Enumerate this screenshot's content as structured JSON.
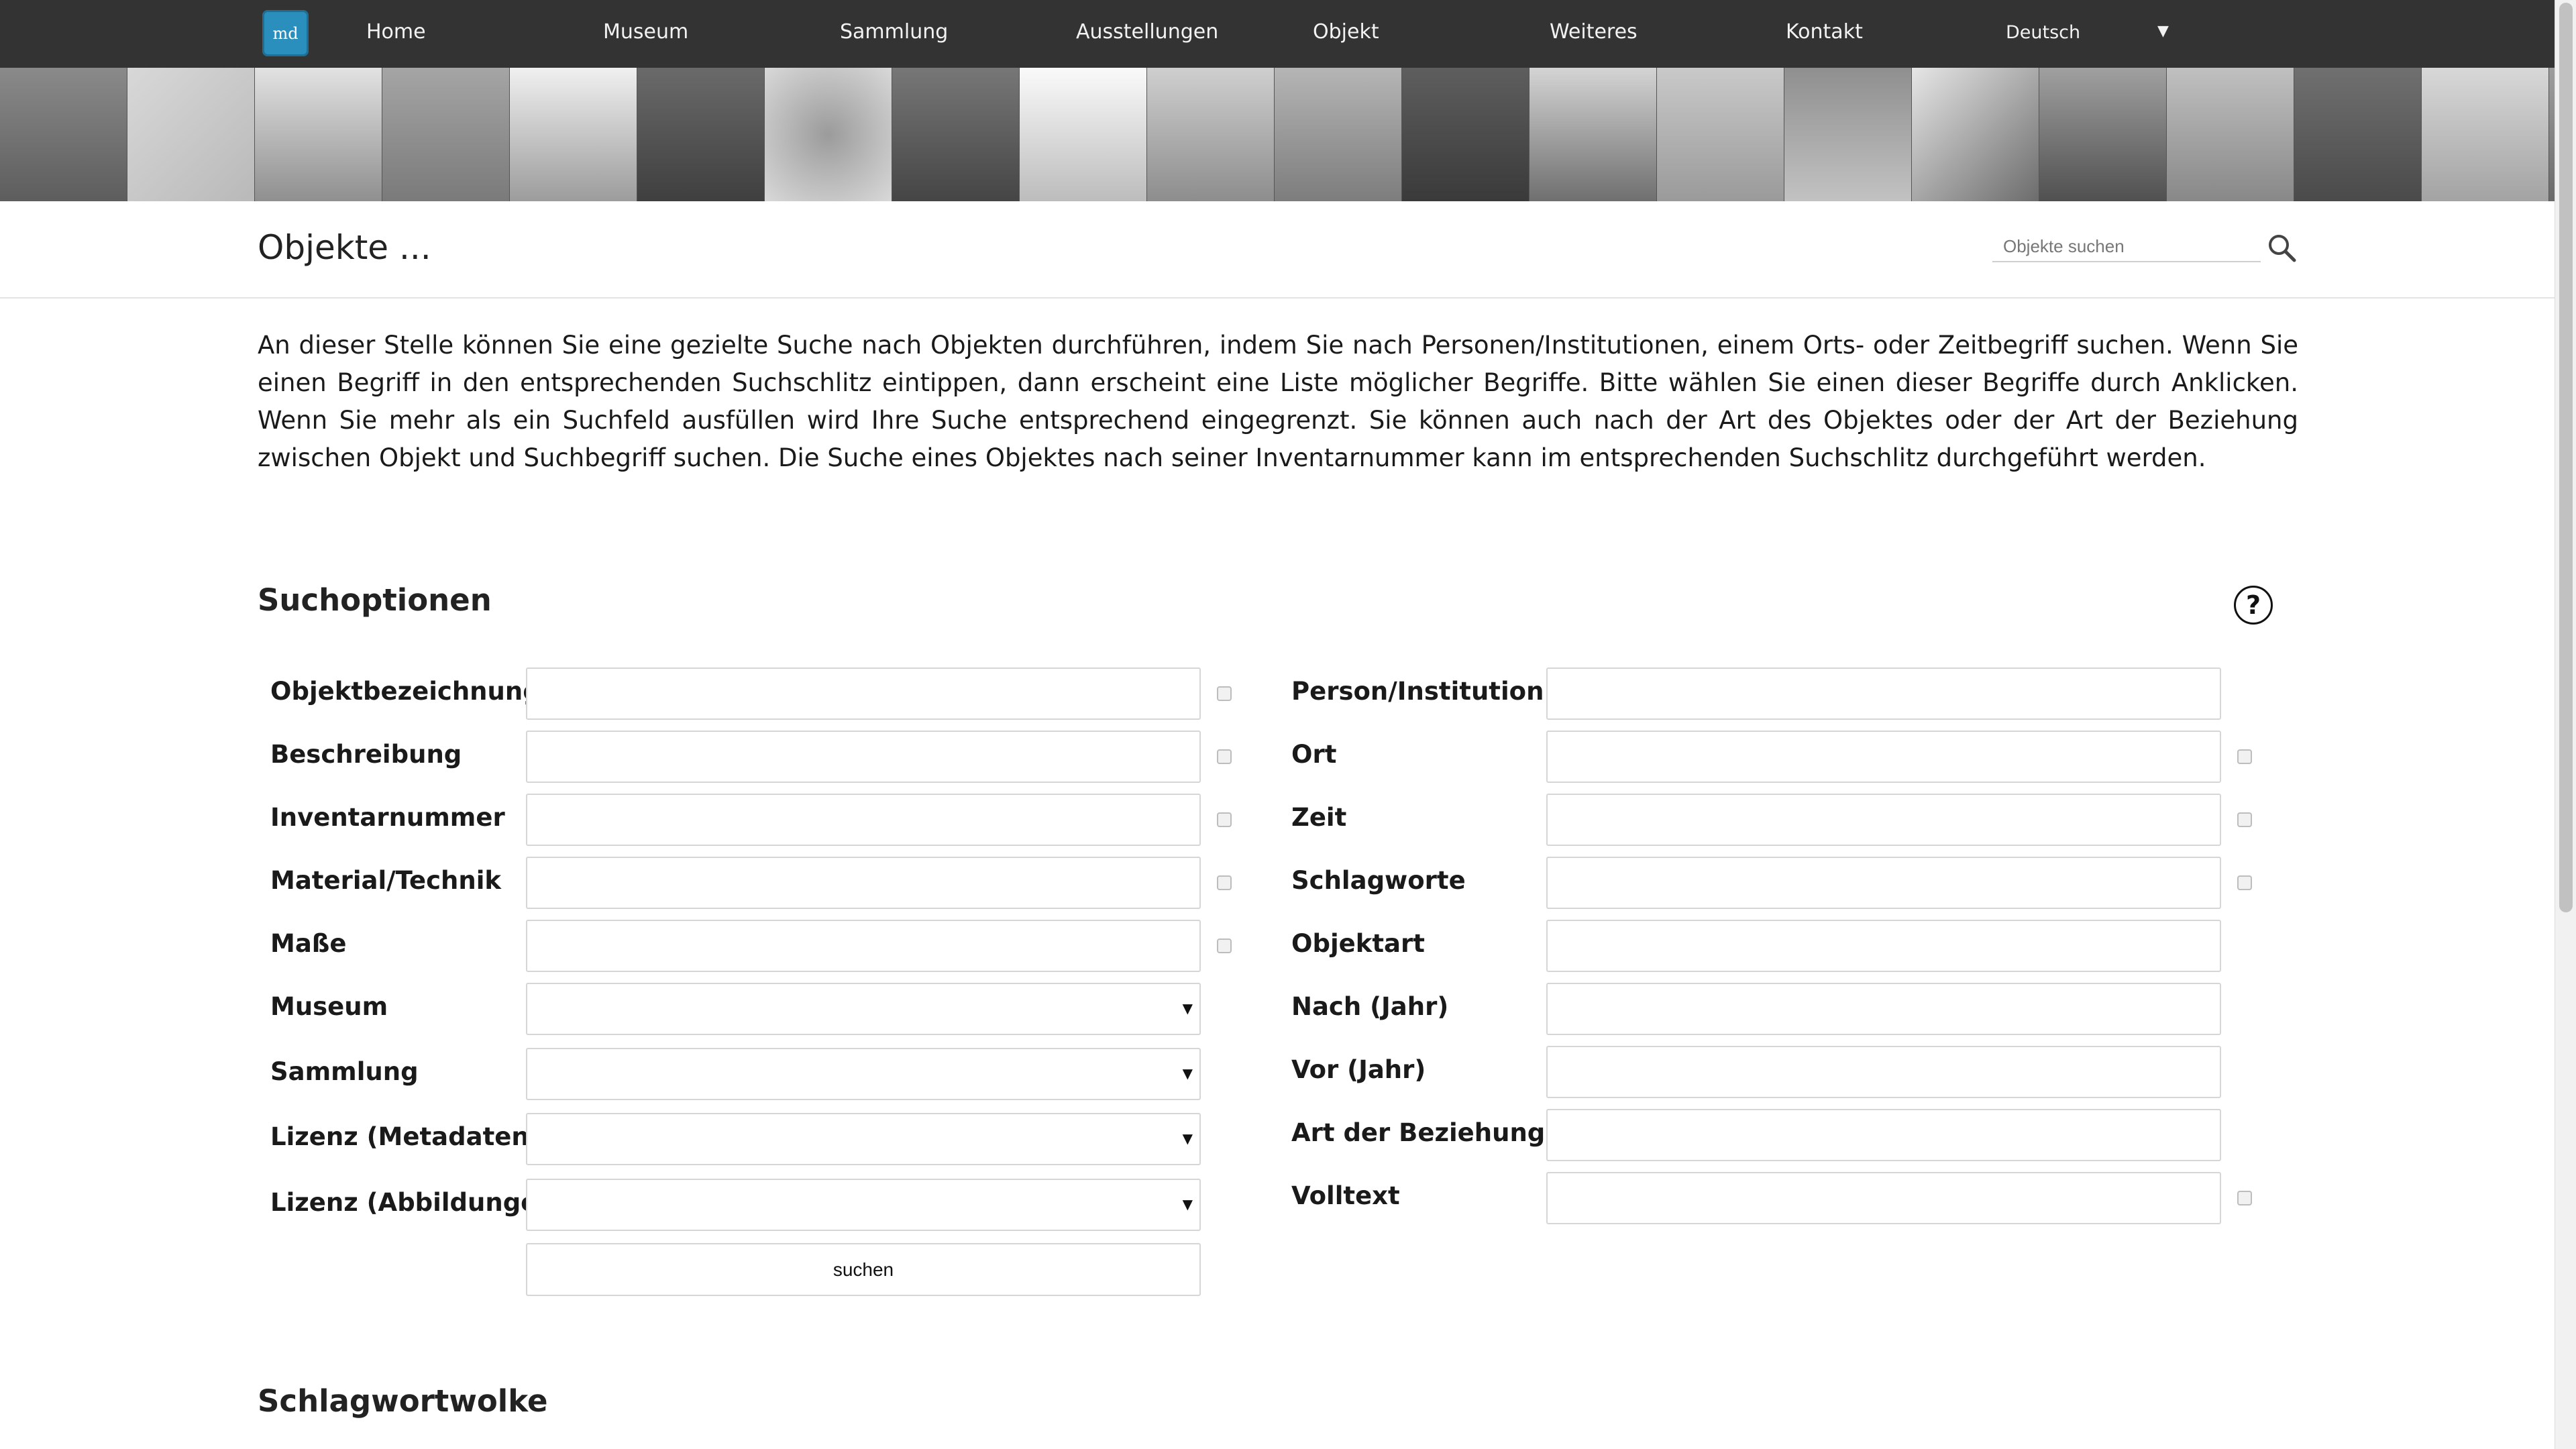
{
  "nav": {
    "logo": "md",
    "items": [
      "Home",
      "Museum",
      "Sammlung",
      "Ausstellungen",
      "Objekt",
      "Weiteres",
      "Kontakt"
    ],
    "language": "Deutsch"
  },
  "header": {
    "title": "Objekte ...",
    "search_placeholder": "Objekte suchen"
  },
  "intro": "An dieser Stelle können Sie eine gezielte Suche nach Objekten durchführen, indem Sie nach Personen/Institutionen, einem Orts- oder Zeitbegriff suchen. Wenn Sie einen Begriff in den entsprechenden Suchschlitz eintippen, dann erscheint eine Liste möglicher Begriffe. Bitte wählen Sie einen dieser Begriffe durch Anklicken. Wenn Sie mehr als ein Suchfeld ausfüllen wird Ihre Suche entsprechend eingegrenzt. Sie können auch nach der Art des Objektes oder der Art der Beziehung zwischen Objekt und Suchbegriff suchen. Die Suche eines Objektes nach seiner Inventarnummer kann im entsprechenden Suchschlitz durchgeführt werden.",
  "search_options": {
    "heading": "Suchoptionen",
    "help": "?",
    "left": [
      {
        "label": "Objektbezeichnung",
        "type": "text",
        "value": "",
        "checkbox": true
      },
      {
        "label": "Beschreibung",
        "type": "text",
        "value": "",
        "checkbox": true
      },
      {
        "label": "Inventarnummer",
        "type": "text",
        "value": "",
        "checkbox": true
      },
      {
        "label": "Material/Technik",
        "type": "text",
        "value": "",
        "checkbox": true
      },
      {
        "label": "Maße",
        "type": "text",
        "value": "",
        "checkbox": true
      },
      {
        "label": "Museum",
        "type": "select",
        "value": "",
        "checkbox": false
      },
      {
        "label": "Sammlung",
        "type": "select",
        "value": "",
        "checkbox": false
      },
      {
        "label": "Lizenz (Metadaten)",
        "type": "select",
        "value": "",
        "checkbox": false
      },
      {
        "label": "Lizenz (Abbildungen)",
        "type": "select",
        "value": "",
        "checkbox": false
      }
    ],
    "right": [
      {
        "label": "Person/Institution",
        "type": "text",
        "value": "",
        "checkbox": false
      },
      {
        "label": "Ort",
        "type": "text",
        "value": "",
        "checkbox": true
      },
      {
        "label": "Zeit",
        "type": "text",
        "value": "",
        "checkbox": true
      },
      {
        "label": "Schlagworte",
        "type": "text",
        "value": "",
        "checkbox": true
      },
      {
        "label": "Objektart",
        "type": "text",
        "value": "",
        "checkbox": false
      },
      {
        "label": "Nach (Jahr)",
        "type": "text",
        "value": "",
        "checkbox": false
      },
      {
        "label": "Vor (Jahr)",
        "type": "text",
        "value": "",
        "checkbox": false
      },
      {
        "label": "Art der Beziehung",
        "type": "text",
        "value": "",
        "checkbox": false
      },
      {
        "label": "Volltext",
        "type": "text",
        "value": "",
        "checkbox": true
      }
    ],
    "submit_label": "suchen"
  },
  "tag_cloud": {
    "heading": "Schlagwortwolke"
  }
}
